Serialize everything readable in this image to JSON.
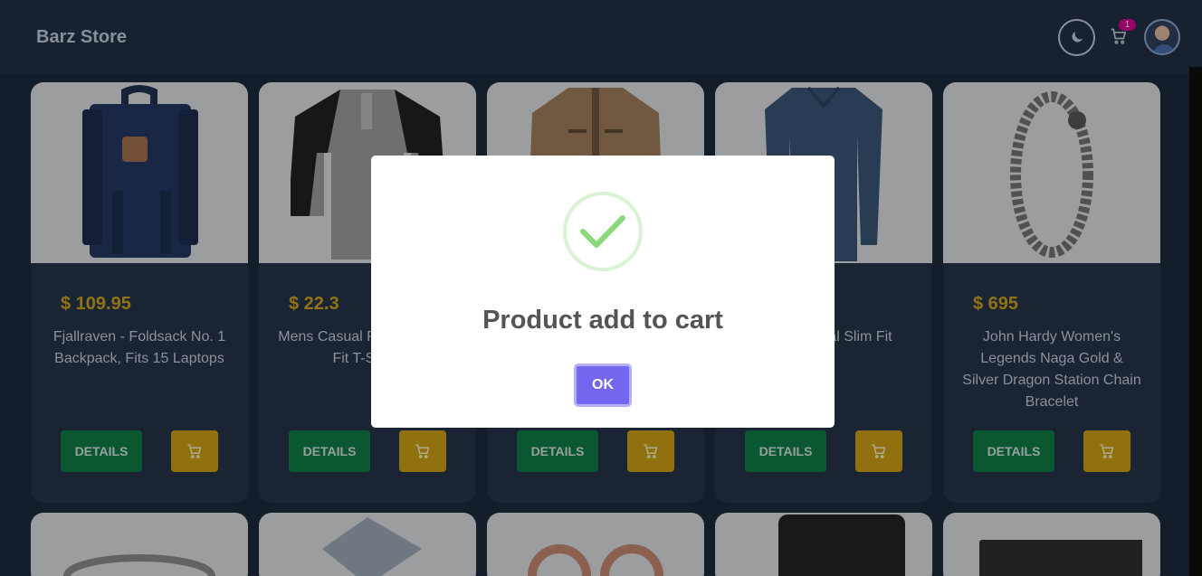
{
  "navbar": {
    "brand": "Barz Store",
    "cart_count": "1"
  },
  "products": [
    {
      "price": "$ 109.95",
      "title": "Fjallraven - Foldsack No. 1 Backpack, Fits 15 Laptops",
      "details_label": "DETAILS",
      "image": "backpack"
    },
    {
      "price": "$ 22.3",
      "title": "Mens Casual Premium Slim Fit T-Shirts",
      "details_label": "DETAILS",
      "image": "raglan-tshirt"
    },
    {
      "price": "",
      "title": "",
      "details_label": "DETAILS",
      "image": "cotton-jacket"
    },
    {
      "price": "",
      "title": "Mens Casual Slim Fit",
      "details_label": "DETAILS",
      "image": "long-sleeve-shirt"
    },
    {
      "price": "$ 695",
      "title": "John Hardy Women's Legends Naga Gold & Silver Dragon Station Chain Bracelet",
      "details_label": "DETAILS",
      "image": "chain-bracelet"
    }
  ],
  "second_row": [
    {
      "image": "ring"
    },
    {
      "image": "diamond-ring"
    },
    {
      "image": "rose-gold-earrings"
    },
    {
      "image": "portable-hard-drive"
    },
    {
      "image": "ssd-drive"
    }
  ],
  "modal": {
    "title": "Product add to cart",
    "ok_label": "OK",
    "icon": "success-check-icon"
  },
  "colors": {
    "price": "#d2a214",
    "details_button": "#0b7a3e",
    "cart_button": "#d19f0c",
    "ok_button": "#7367f0",
    "badge": "#d6008a"
  }
}
